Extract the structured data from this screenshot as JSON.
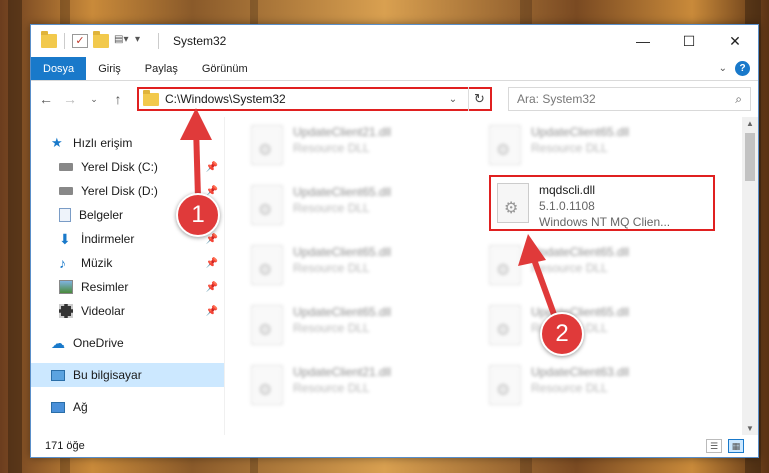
{
  "window": {
    "title": "System32"
  },
  "ribbon": {
    "tabs": [
      "Dosya",
      "Giriş",
      "Paylaş",
      "Görünüm"
    ]
  },
  "nav": {
    "address": "C:\\Windows\\System32",
    "search_placeholder": "Ara: System32"
  },
  "sidebar": {
    "items": [
      {
        "label": "Hızlı erişim",
        "icon": "star-icon",
        "group": true
      },
      {
        "label": "Yerel Disk (C:)",
        "icon": "drive-icon",
        "pinned": true
      },
      {
        "label": "Yerel Disk (D:)",
        "icon": "drive-icon",
        "pinned": true
      },
      {
        "label": "Belgeler",
        "icon": "documents-icon",
        "pinned": true
      },
      {
        "label": "İndirmeler",
        "icon": "download-icon",
        "pinned": true
      },
      {
        "label": "Müzik",
        "icon": "music-icon",
        "pinned": true
      },
      {
        "label": "Resimler",
        "icon": "pictures-icon",
        "pinned": true
      },
      {
        "label": "Videolar",
        "icon": "videos-icon",
        "pinned": true
      },
      {
        "label": "OneDrive",
        "icon": "cloud-icon",
        "group": true
      },
      {
        "label": "Bu bilgisayar",
        "icon": "computer-icon",
        "group": true,
        "selected": true
      },
      {
        "label": "Ağ",
        "icon": "network-icon",
        "group": true
      }
    ]
  },
  "files": {
    "left": [
      {
        "name": "UpdateClient21.dll",
        "desc": "Resource DLL"
      },
      {
        "name": "UpdateClient65.dll",
        "desc": "Resource DLL"
      },
      {
        "name": "UpdateClient65.dll",
        "desc": "Resource DLL"
      },
      {
        "name": "UpdateClient65.dll",
        "desc": "Resource DLL"
      },
      {
        "name": "UpdateClient21.dll",
        "desc": "Resource DLL"
      }
    ],
    "right": [
      {
        "name": "UpdateClient65.dll",
        "desc": "Resource DLL"
      },
      {
        "name": "mqdscli.dll",
        "version": "5.1.0.1108",
        "desc": "Windows NT MQ Clien...",
        "highlight": true
      },
      {
        "name": "UpdateClient65.dll",
        "desc": "Resource DLL"
      },
      {
        "name": "UpdateClient65.dll",
        "desc": "Resource DLL"
      },
      {
        "name": "UpdateClient63.dll",
        "desc": "Resource DLL"
      }
    ]
  },
  "status": {
    "count": "171 öğe"
  },
  "callouts": {
    "one": "1",
    "two": "2"
  },
  "colors": {
    "accent": "#1979ca",
    "highlight": "#e02020",
    "badge": "#e03a3a"
  }
}
